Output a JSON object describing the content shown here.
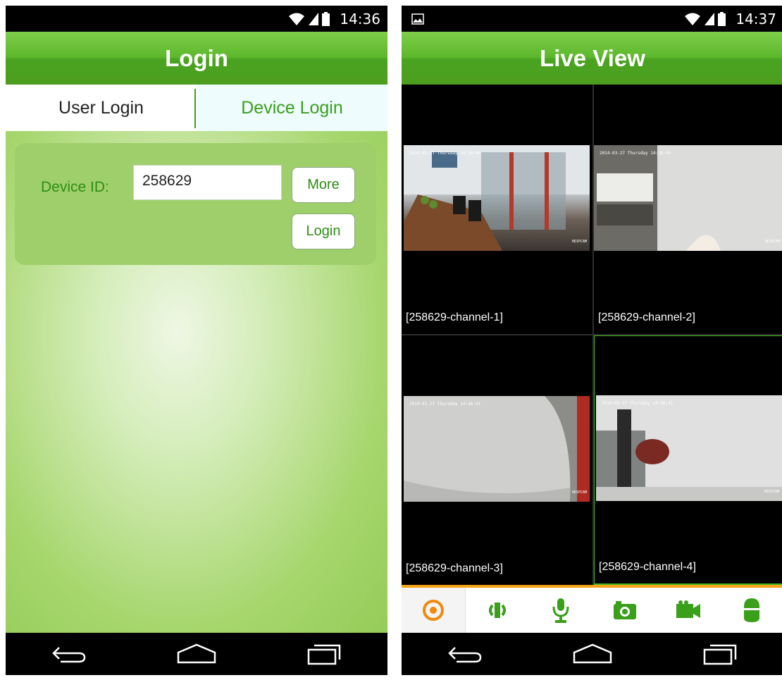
{
  "left": {
    "status": {
      "time": "14:36"
    },
    "title": "Login",
    "tabs": {
      "user": "User Login",
      "device": "Device Login"
    },
    "form": {
      "device_id_label": "Device ID:",
      "device_id_value": "258629",
      "more_label": "More",
      "login_label": "Login"
    }
  },
  "right": {
    "status": {
      "time": "14:37"
    },
    "title": "Live View",
    "channels": [
      {
        "label": "[258629-channel-1]",
        "timestamp": "2014-03-27 Thursday 14:36:44",
        "watermark": "HDIPCAM"
      },
      {
        "label": "[258629-channel-2]",
        "timestamp": "2014-03-27 Thursday 14:36:44",
        "watermark": "HDIPCAM"
      },
      {
        "label": "[258629-channel-3]",
        "timestamp": "2014-03-27 Thursday 14:36:41",
        "watermark": "HDIPCAM"
      },
      {
        "label": "[258629-channel-4]",
        "timestamp": "2014-03-27 Thursday 14:36:41",
        "watermark": "HDIPCAM"
      }
    ],
    "selected_channel": 4,
    "toolbar_icons": [
      "preview-icon",
      "speaker-icon",
      "microphone-icon",
      "camera-icon",
      "video-record-icon",
      "ptz-icon"
    ]
  },
  "colors": {
    "green": "#5db82c",
    "accent_green": "#3aa01a",
    "orange": "#f4a21a"
  }
}
